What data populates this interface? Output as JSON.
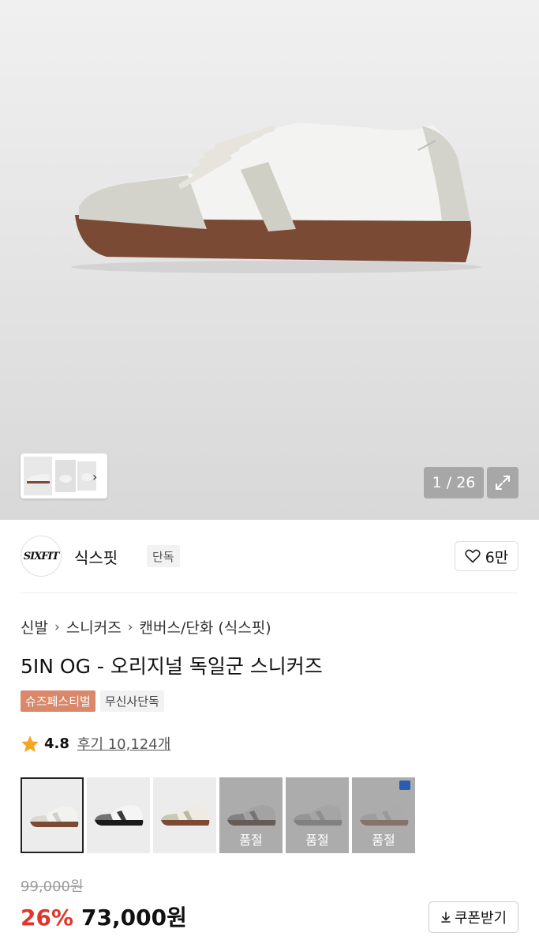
{
  "gallery": {
    "counter": "1 / 26",
    "hero_alt": "sneaker-photo"
  },
  "brand": {
    "logo_text": "SIXFIT",
    "name": "식스핏",
    "badge": "단독",
    "likes": "6만"
  },
  "breadcrumb": [
    "신발",
    "스니커즈",
    "캔버스/단화 (식스핏)"
  ],
  "product": {
    "title": "5IN OG - 오리지널 독일군 스니커즈",
    "tags": [
      "슈즈페스티벌",
      "무신사단독"
    ],
    "rating": "4.8",
    "reviews": "후기 10,124개"
  },
  "colors": [
    {
      "name": "white-gum",
      "upper": "#f2f2ef",
      "accent": "#cfcfc6",
      "sole": "#7a4a34",
      "soldout": false
    },
    {
      "name": "white-black",
      "upper": "#f5f5f5",
      "accent": "#3a3a3a",
      "sole": "#1a1a1a",
      "soldout": false
    },
    {
      "name": "cream-gum",
      "upper": "#efebe3",
      "accent": "#b7b9a3",
      "sole": "#7a4a34",
      "soldout": false
    },
    {
      "name": "grey-gum",
      "upper": "#d8d8d8",
      "accent": "#6f6f6f",
      "sole": "#4e3a30",
      "soldout": true,
      "soldout_label": "품절"
    },
    {
      "name": "light-grey",
      "upper": "#dcdcdc",
      "accent": "#a9a9a9",
      "sole": "#8c8c8c",
      "soldout": true,
      "soldout_label": "품절"
    },
    {
      "name": "white-silver",
      "upper": "#e8e8ea",
      "accent": "#bfc1c6",
      "sole": "#9a6a5a",
      "soldout": true,
      "soldout_label": "품절"
    }
  ],
  "price": {
    "original": "99,000원",
    "discount": "26%",
    "current": "73,000원",
    "coupon_label": "쿠폰받기"
  },
  "theme": {
    "discount_color": "#e0352b",
    "festival_tag_color": "#d9886a"
  }
}
